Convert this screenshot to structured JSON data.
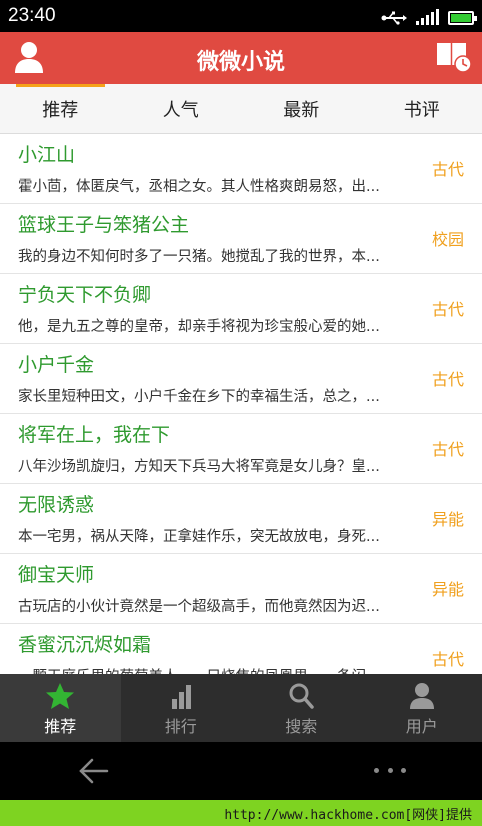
{
  "status": {
    "time": "23:40"
  },
  "header": {
    "title": "微微小说"
  },
  "tabs": [
    {
      "label": "推荐",
      "active": true
    },
    {
      "label": "人气",
      "active": false
    },
    {
      "label": "最新",
      "active": false
    },
    {
      "label": "书评",
      "active": false
    }
  ],
  "books": [
    {
      "title": "小江山",
      "desc": "霍小茴，体匿戾气，丞相之女。其人性格爽朗易怒，出...",
      "genre": "古代"
    },
    {
      "title": "篮球王子与笨猪公主",
      "desc": "我的身边不知何时多了一只猪。她搅乱了我的世界，本...",
      "genre": "校园"
    },
    {
      "title": "宁负天下不负卿",
      "desc": "他，是九五之尊的皇帝，却亲手将视为珍宝般心爱的她...",
      "genre": "古代"
    },
    {
      "title": "小户千金",
      "desc": "家长里短种田文，小户千金在乡下的幸福生活，总之，...",
      "genre": "古代"
    },
    {
      "title": "将军在上，我在下",
      "desc": "八年沙场凯旋归，方知天下兵马大将军竟是女儿身？皇...",
      "genre": "古代"
    },
    {
      "title": "无限诱惑",
      "desc": "本一宅男，祸从天降，正拿娃作乐，突无故放电，身死...",
      "genre": "异能"
    },
    {
      "title": "御宝天师",
      "desc": "古玩店的小伙计竟然是一个超级高手，而他竟然因为迟...",
      "genre": "异能"
    },
    {
      "title": "香蜜沉沉烬如霜",
      "desc": "一颗天庭乐里的葡萄美人，一只烧焦的凤凰男，一条闪...",
      "genre": "古代"
    }
  ],
  "bottom_nav": [
    {
      "label": "推荐",
      "icon": "star-icon",
      "active": true
    },
    {
      "label": "排行",
      "icon": "bar-chart-icon",
      "active": false
    },
    {
      "label": "搜索",
      "icon": "search-icon",
      "active": false
    },
    {
      "label": "用户",
      "icon": "user-icon",
      "active": false
    }
  ],
  "watermark": "http://www.hackhome.com[网侠]提供",
  "colors": {
    "header": "#e04a41",
    "title_green": "#2f9a2f",
    "genre_orange": "#f0a01e",
    "tab_indicator": "#f5a21a",
    "nav_active": "#33b533"
  }
}
